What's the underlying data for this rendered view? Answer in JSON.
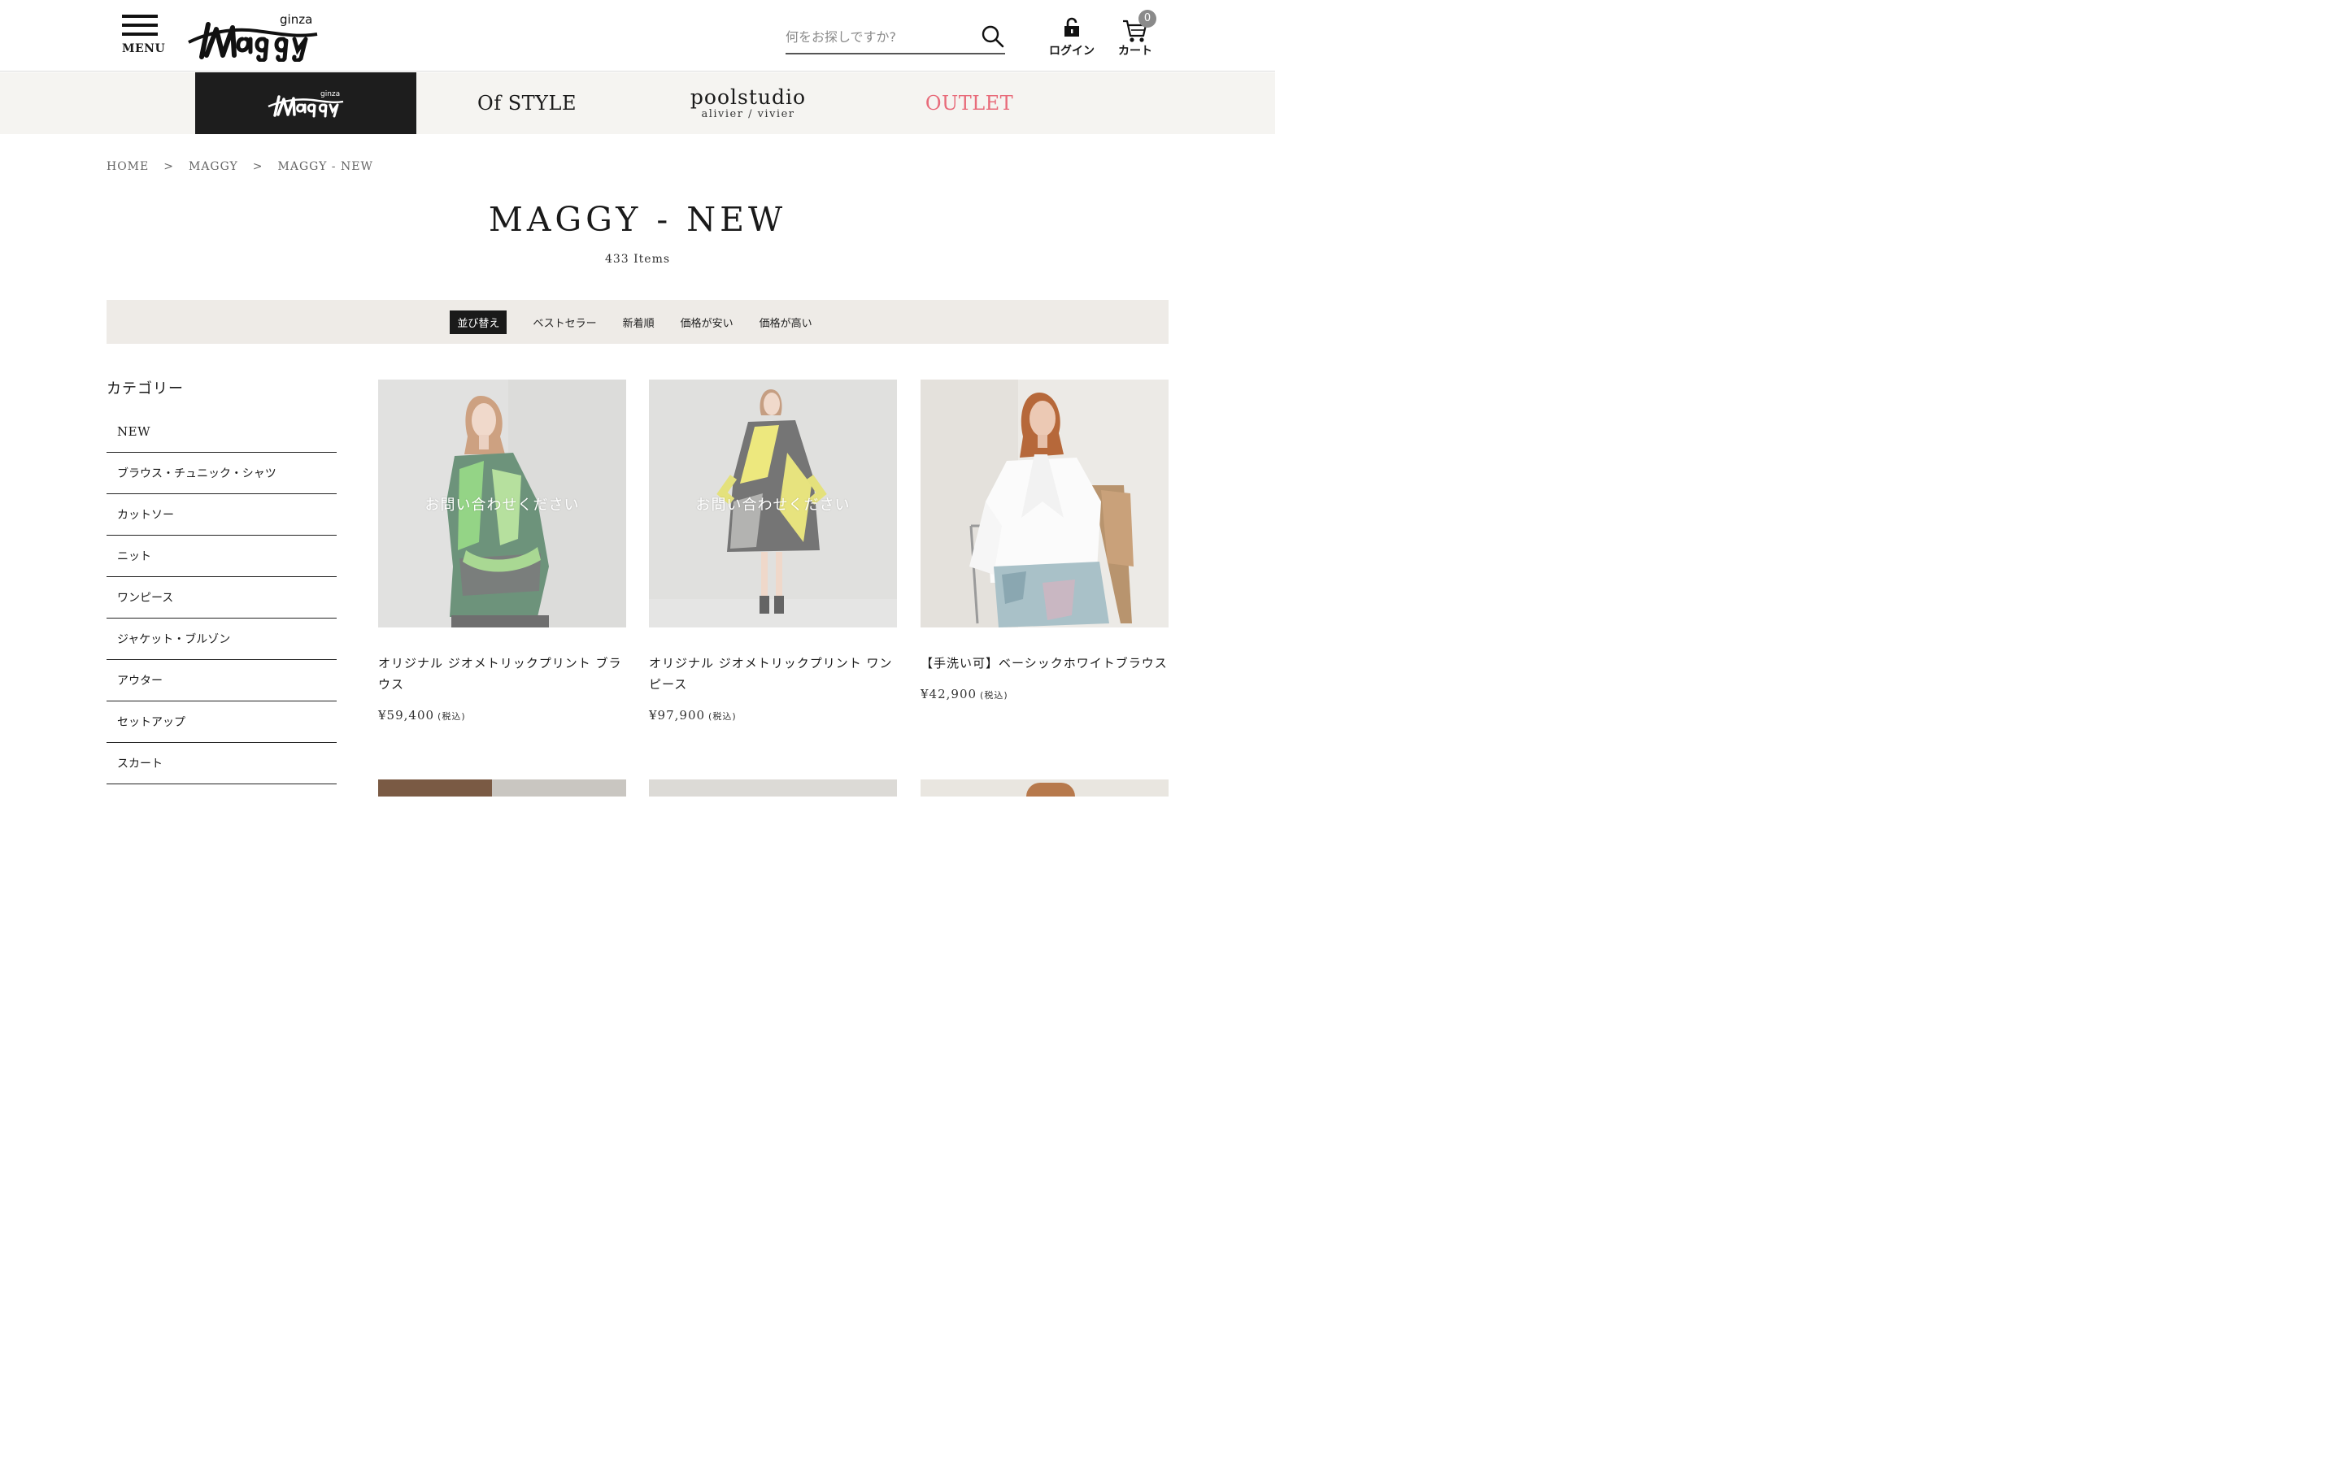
{
  "header": {
    "menu_label": "MENU",
    "logo_text": "ginza Maggy",
    "search_placeholder": "何をお探しですか?",
    "login_label": "ログイン",
    "cart_label": "カート",
    "cart_count": "0"
  },
  "brand_nav": {
    "tabs": [
      {
        "label": "ginza Maggy",
        "active": true
      },
      {
        "label": "Of STYLE"
      },
      {
        "label": "poolstudio",
        "sub": "alivier / vivier"
      },
      {
        "label": "OUTLET",
        "color": "#e86b7a"
      }
    ]
  },
  "breadcrumb": [
    "HOME",
    "MAGGY",
    "MAGGY - NEW"
  ],
  "breadcrumb_separator": ">",
  "page": {
    "title": "MAGGY - NEW",
    "count": "433 Items"
  },
  "sort": {
    "label": "並び替え",
    "options": [
      "ベストセラー",
      "新着順",
      "価格が安い",
      "価格が高い"
    ]
  },
  "sidebar": {
    "title": "カテゴリー",
    "categories": [
      "NEW",
      "ブラウス・チュニック・シャツ",
      "カットソー",
      "ニット",
      "ワンピース",
      "ジャケット・ブルゾン",
      "アウター",
      "セットアップ",
      "スカート"
    ]
  },
  "products": [
    {
      "name": "オリジナル ジオメトリックプリント ブラウス",
      "price": "¥59,400",
      "tax": "(税込)",
      "overlay": "お問い合わせください"
    },
    {
      "name": "オリジナル ジオメトリックプリント ワンピース",
      "price": "¥97,900",
      "tax": "(税込)",
      "overlay": "お問い合わせください"
    },
    {
      "name": "【手洗い可】ベーシックホワイトブラウス",
      "price": "¥42,900",
      "tax": "(税込)"
    }
  ],
  "colors": {
    "accent_outlet": "#e86b7a",
    "sort_bar": "#eeebe7",
    "brand_nav": "#f5f4f1"
  }
}
